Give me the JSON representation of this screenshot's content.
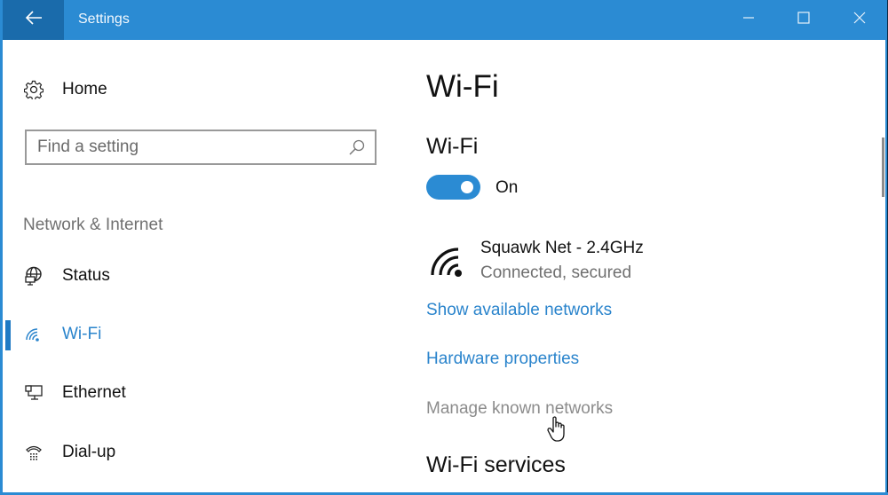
{
  "window": {
    "title": "Settings",
    "accent_color": "#2b8bd3",
    "back_button_color": "#1a6bab",
    "controls": {
      "minimize_icon": "minimize-icon",
      "maximize_icon": "maximize-icon",
      "close_icon": "close-icon"
    },
    "back_icon": "arrow-left-icon"
  },
  "sidebar": {
    "home": {
      "label": "Home",
      "icon": "gear-icon"
    },
    "search": {
      "placeholder": "Find a setting",
      "value": "",
      "icon": "search-icon"
    },
    "section_label": "Network & Internet",
    "items": [
      {
        "label": "Status",
        "icon": "globe-icon",
        "selected": false
      },
      {
        "label": "Wi-Fi",
        "icon": "wifi-icon",
        "selected": true
      },
      {
        "label": "Ethernet",
        "icon": "ethernet-icon",
        "selected": false
      },
      {
        "label": "Dial-up",
        "icon": "dialup-icon",
        "selected": false
      }
    ]
  },
  "main": {
    "page_title": "Wi-Fi",
    "wifi_section_title": "Wi-Fi",
    "toggle": {
      "state": "on",
      "label": "On"
    },
    "network": {
      "name": "Squawk Net - 2.4GHz",
      "status": "Connected, secured",
      "icon": "wifi-signal-icon"
    },
    "links": {
      "show_available": "Show available networks",
      "hardware_properties": "Hardware properties",
      "manage_known": "Manage known networks"
    },
    "services_title": "Wi-Fi services",
    "link_color": "#2a84cc"
  }
}
